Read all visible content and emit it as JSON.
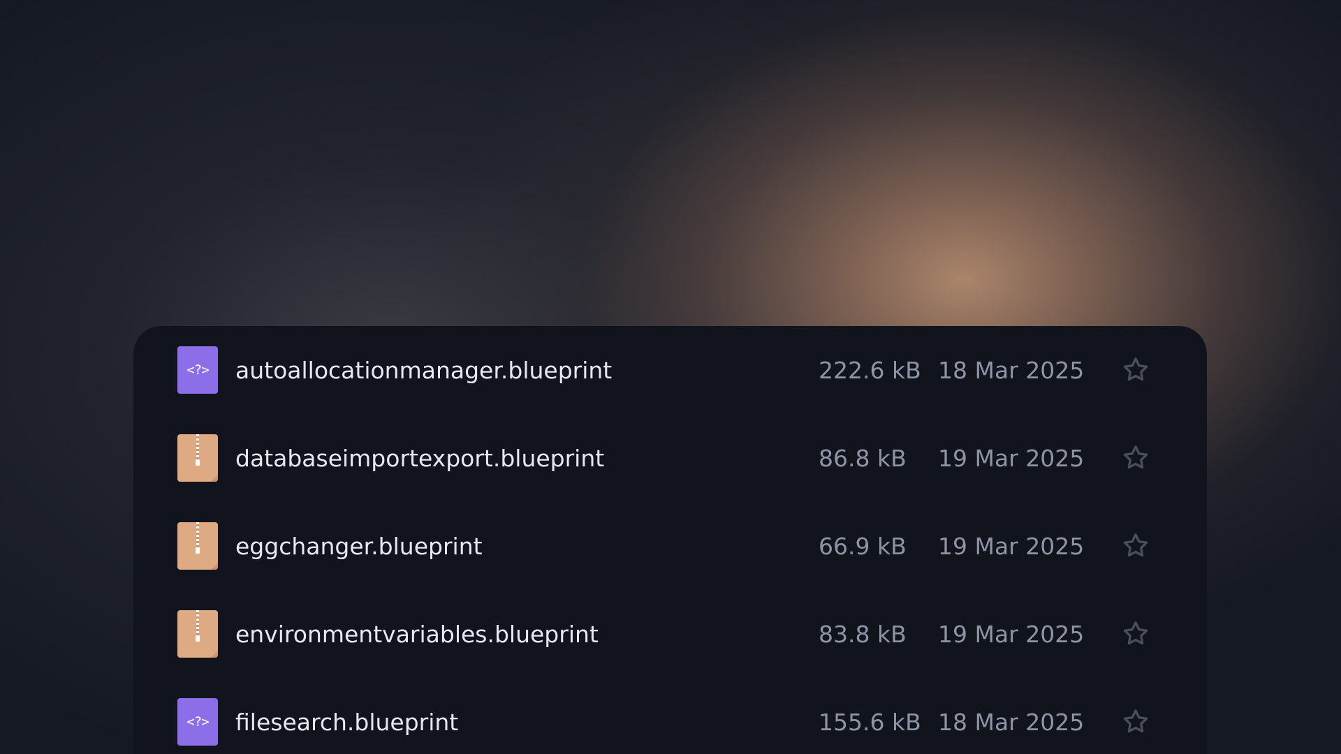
{
  "files": [
    {
      "name": "autoallocationmanager.blueprint",
      "size": "222.6 kB",
      "date": "18 Mar 2025",
      "icon": "code-file-icon",
      "starred": false
    },
    {
      "name": "databaseimportexport.blueprint",
      "size": "86.8 kB",
      "date": "19 Mar 2025",
      "icon": "archive-file-icon",
      "starred": false
    },
    {
      "name": "eggchanger.blueprint",
      "size": "66.9 kB",
      "date": "19 Mar 2025",
      "icon": "archive-file-icon",
      "starred": false
    },
    {
      "name": "environmentvariables.blueprint",
      "size": "83.8 kB",
      "date": "19 Mar 2025",
      "icon": "archive-file-icon",
      "starred": false
    },
    {
      "name": "filesearch.blueprint",
      "size": "155.6 kB",
      "date": "18 Mar 2025",
      "icon": "code-file-icon",
      "starred": false
    }
  ],
  "code_icon_glyph": "<?>",
  "colors": {
    "panel": "#11141c",
    "code_icon": "#8b6ee8",
    "archive_icon": "#deaa84",
    "text_primary": "#e6e8ef",
    "text_secondary": "#8e94a3",
    "star": "#4a4f5c"
  }
}
